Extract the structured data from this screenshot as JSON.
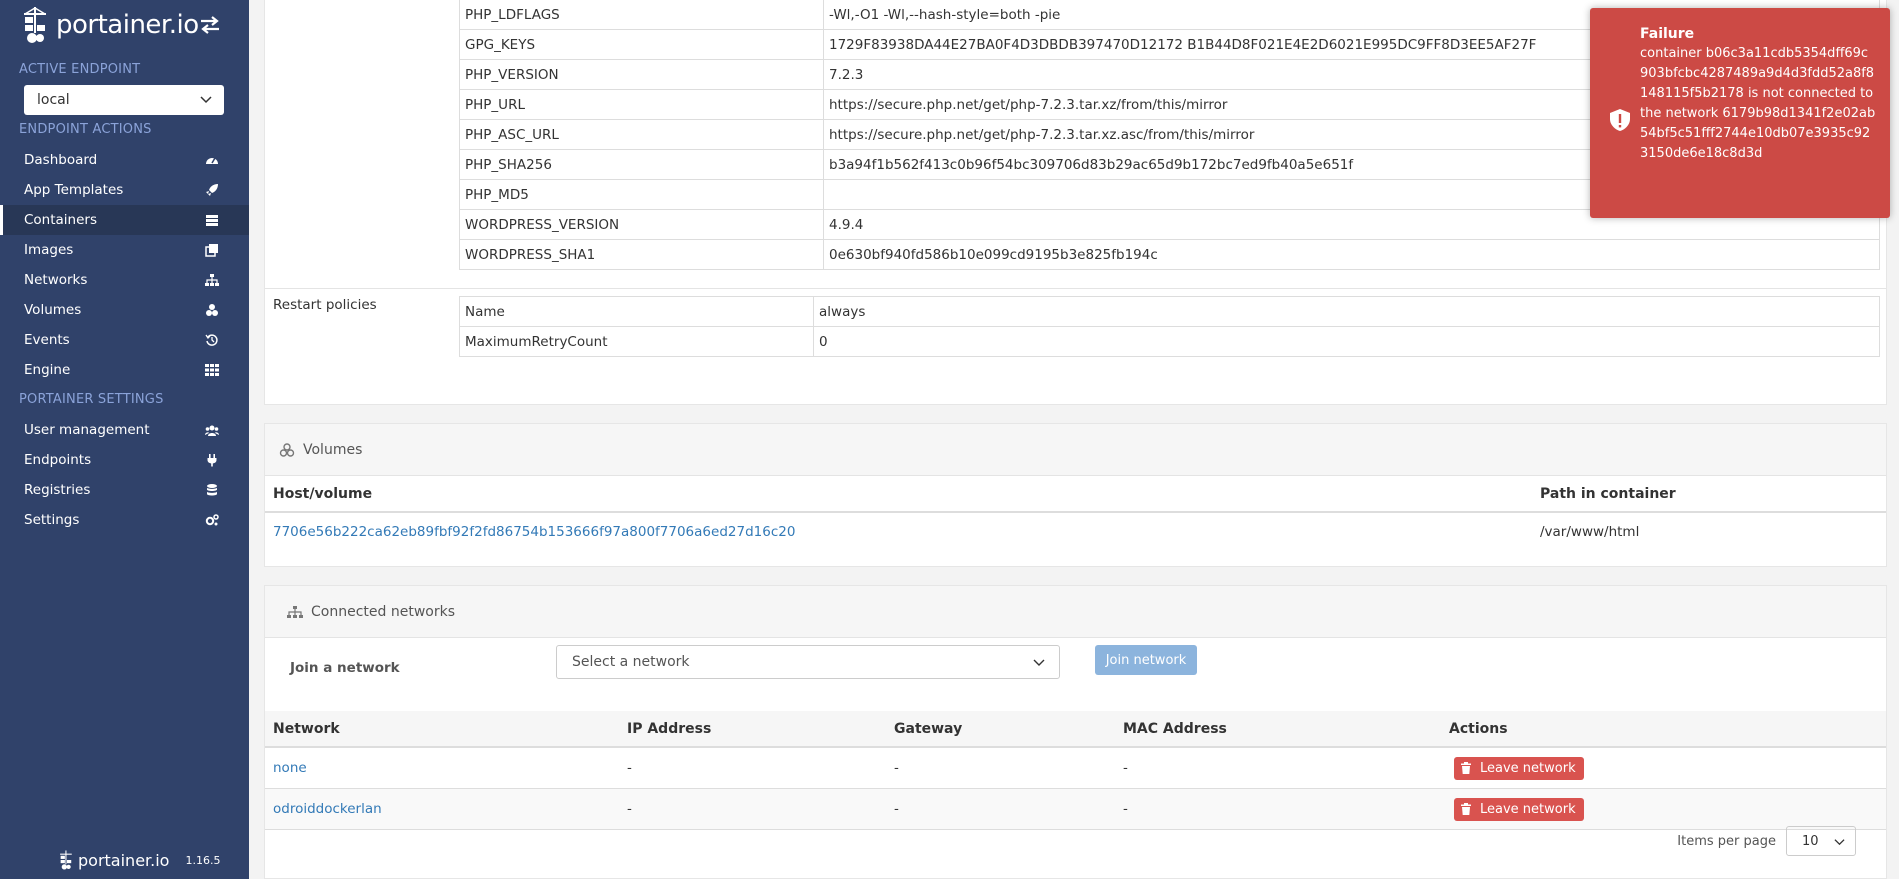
{
  "brand": {
    "name": "portainer.io",
    "version": "1.16.5"
  },
  "sidebar": {
    "active_endpoint_title": "ACTIVE ENDPOINT",
    "endpoint_value": "local",
    "endpoint_actions_title": "ENDPOINT ACTIONS",
    "endpoint_items": [
      {
        "label": "Dashboard",
        "icon": "dashboard-icon"
      },
      {
        "label": "App Templates",
        "icon": "rocket-icon"
      },
      {
        "label": "Containers",
        "icon": "list-icon",
        "active": true
      },
      {
        "label": "Images",
        "icon": "clone-icon"
      },
      {
        "label": "Networks",
        "icon": "sitemap-icon"
      },
      {
        "label": "Volumes",
        "icon": "cubes-icon"
      },
      {
        "label": "Events",
        "icon": "history-icon"
      },
      {
        "label": "Engine",
        "icon": "th-icon"
      }
    ],
    "settings_title": "PORTAINER SETTINGS",
    "settings_items": [
      {
        "label": "User management",
        "icon": "users-icon"
      },
      {
        "label": "Endpoints",
        "icon": "plug-icon"
      },
      {
        "label": "Registries",
        "icon": "database-icon"
      },
      {
        "label": "Settings",
        "icon": "cogs-icon"
      }
    ]
  },
  "env": {
    "rows": [
      {
        "key": "PHP_LDFLAGS",
        "value": "-Wl,-O1 -Wl,--hash-style=both -pie"
      },
      {
        "key": "GPG_KEYS",
        "value": "1729F83938DA44E27BA0F4D3DBDB397470D12172 B1B44D8F021E4E2D6021E995DC9FF8D3EE5AF27F"
      },
      {
        "key": "PHP_VERSION",
        "value": "7.2.3"
      },
      {
        "key": "PHP_URL",
        "value": "https://secure.php.net/get/php-7.2.3.tar.xz/from/this/mirror"
      },
      {
        "key": "PHP_ASC_URL",
        "value": "https://secure.php.net/get/php-7.2.3.tar.xz.asc/from/this/mirror"
      },
      {
        "key": "PHP_SHA256",
        "value": "b3a94f1b562f413c0b96f54bc309706d83b29ac65d9b172bc7ed9fb40a5e651f"
      },
      {
        "key": "PHP_MD5",
        "value": ""
      },
      {
        "key": "WORDPRESS_VERSION",
        "value": "4.9.4"
      },
      {
        "key": "WORDPRESS_SHA1",
        "value": "0e630bf940fd586b10e099cd9195b3e825fb194c"
      }
    ]
  },
  "restart": {
    "label": "Restart policies",
    "rows": [
      {
        "key": "Name",
        "value": "always"
      },
      {
        "key": "MaximumRetryCount",
        "value": "0"
      }
    ]
  },
  "volumes": {
    "title": "Volumes",
    "col_host": "Host/volume",
    "col_path": "Path in container",
    "rows": [
      {
        "host": "7706e56b222ca62eb89fbf92f2fd86754b153666f97a800f7706a6ed27d16c20",
        "path": "/var/www/html"
      }
    ]
  },
  "networks": {
    "title": "Connected networks",
    "join_label": "Join a network",
    "select_placeholder": "Select a network",
    "join_button": "Join network",
    "columns": {
      "network": "Network",
      "ip": "IP Address",
      "gateway": "Gateway",
      "mac": "MAC Address",
      "actions": "Actions"
    },
    "rows": [
      {
        "network": "none",
        "ip": "-",
        "gateway": "-",
        "mac": "-",
        "action": "Leave network"
      },
      {
        "network": "odroiddockerlan",
        "ip": "-",
        "gateway": "-",
        "mac": "-",
        "action": "Leave network"
      }
    ],
    "items_per_page_label": "Items per page",
    "items_per_page_value": "10"
  },
  "toast": {
    "title": "Failure",
    "message": "container b06c3a11cdb5354dff69c903bfcbc4287489a9d4d3fdd52a8f8148115f5b2178 is not connected to the network 6179b98d1341f2e02ab54bf5c51fff2744e10db07e3935c923150de6e18c8d3d"
  },
  "colors": {
    "sidebar": "#30426a",
    "toast": "#cc4a45",
    "link": "#337ab7",
    "danger": "#d9534f"
  }
}
